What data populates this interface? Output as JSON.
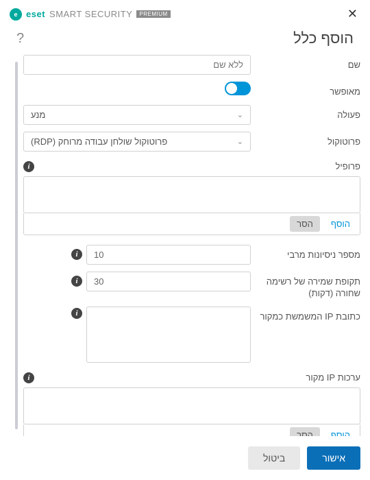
{
  "brand": {
    "eset": "eset",
    "product": "SMART SECURITY",
    "edition": "PREMIUM"
  },
  "title": "הוסף כלל",
  "labels": {
    "name": "שם",
    "enabled": "מאופשר",
    "action": "פעולה",
    "protocol": "פרוטוקול",
    "profile": "פרופיל",
    "max_attempts": "מספר ניסיונות מרבי",
    "blacklist_retention": "תקופת שמירה של רשימה שחורה (דקות)",
    "source_ip": "כתובת IP המשמשת כמקור",
    "source_ip_sets": "ערכות IP מקור"
  },
  "values": {
    "name_placeholder": "ללא שם",
    "action": "מנע",
    "protocol": "פרוטוקול שולחן עבודה מרוחק (RDP)",
    "max_attempts": "10",
    "blacklist_retention": "30"
  },
  "buttons": {
    "add": "הוסף",
    "remove": "הסר",
    "ok": "אישור",
    "cancel": "ביטול"
  }
}
